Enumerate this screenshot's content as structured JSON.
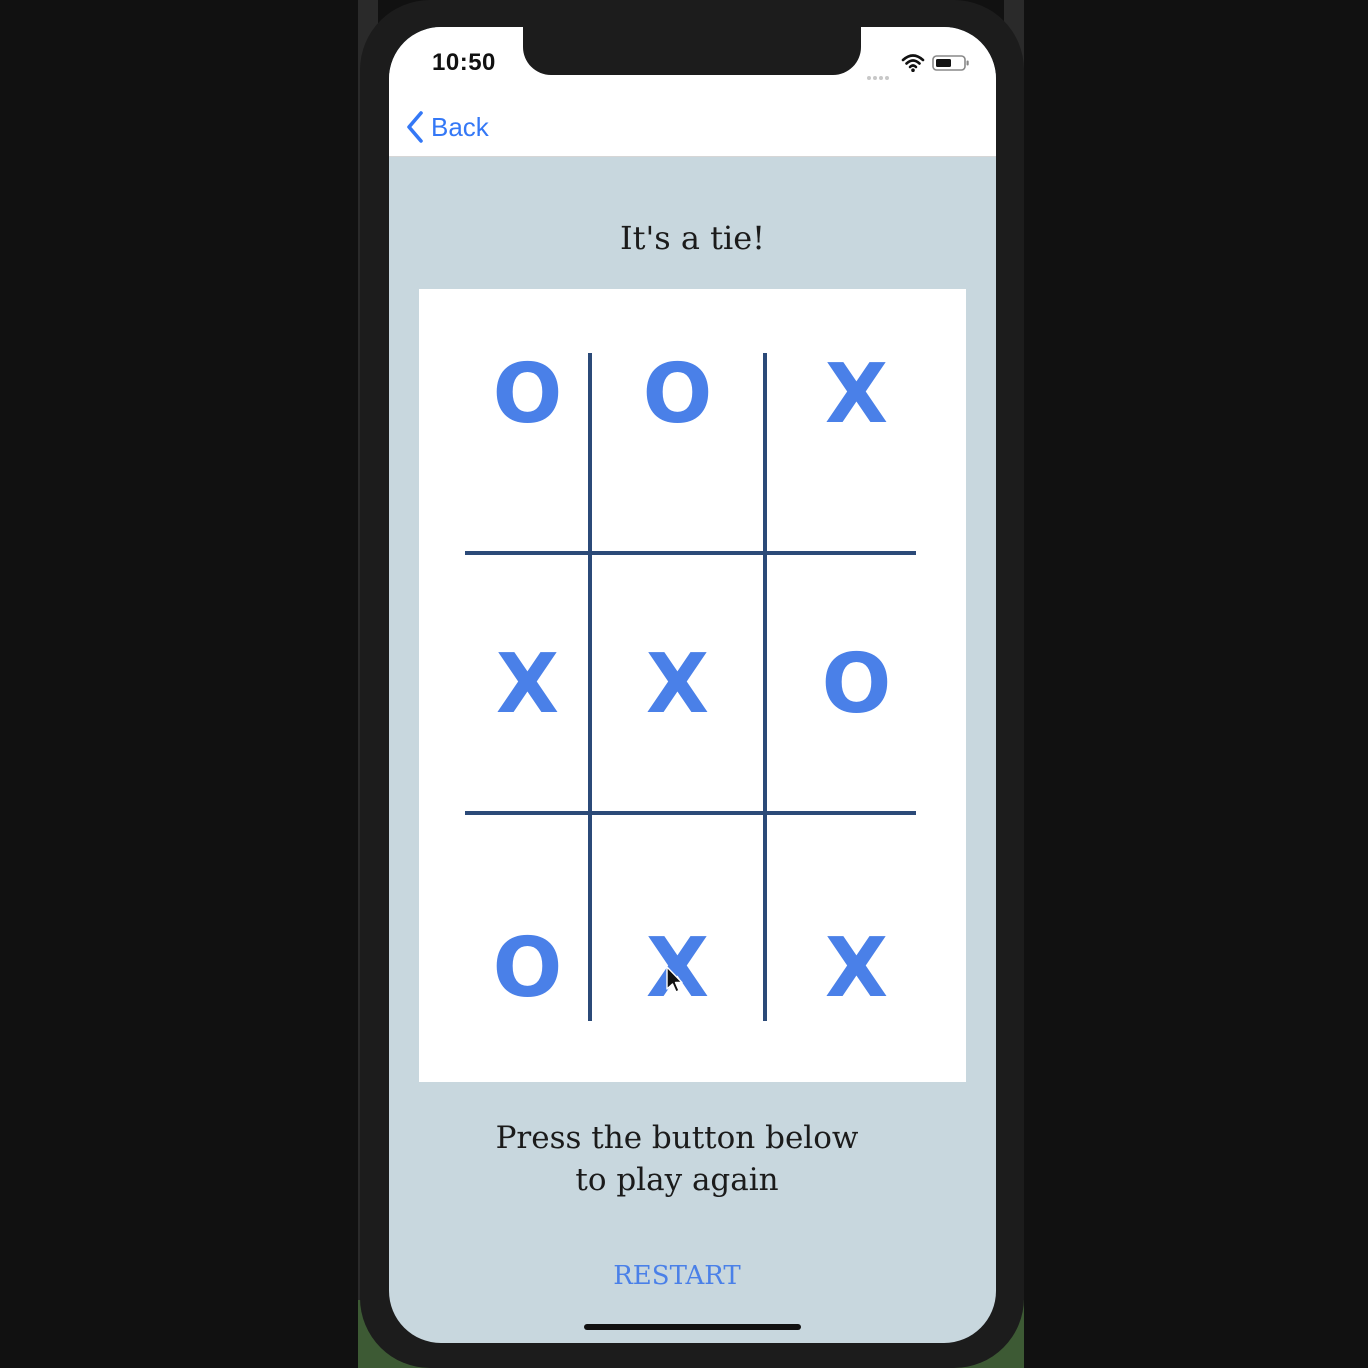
{
  "status_bar": {
    "time": "10:50"
  },
  "nav": {
    "back_label": "Back"
  },
  "game": {
    "status_message": "It's a tie!",
    "board": [
      [
        "O",
        "O",
        "X"
      ],
      [
        "X",
        "X",
        "O"
      ],
      [
        "O",
        "X",
        "X"
      ]
    ],
    "prompt_line1": "Press the button below",
    "prompt_line2": "to play again",
    "restart_label": "RESTART"
  },
  "colors": {
    "background": "#c8d7de",
    "board_background": "#ffffff",
    "grid_line": "#2b4a78",
    "mark": "#4a80e8",
    "link": "#3478f6"
  }
}
